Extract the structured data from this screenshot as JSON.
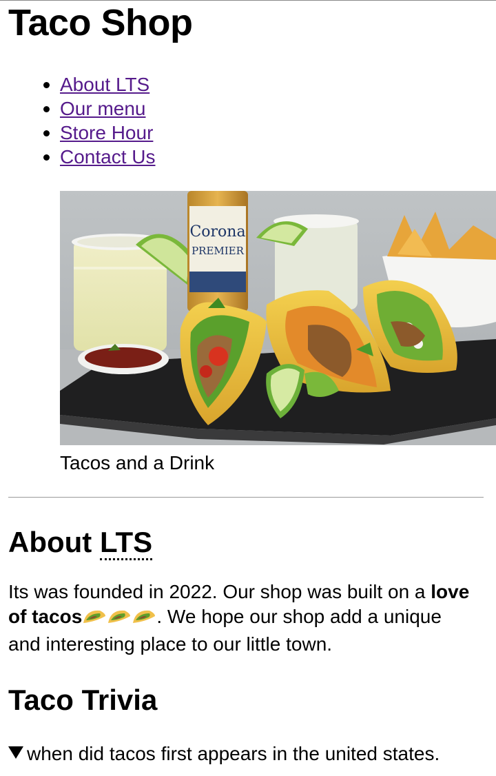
{
  "site": {
    "title": "Taco Shop"
  },
  "nav": {
    "items": [
      {
        "label": "About LTS"
      },
      {
        "label": "Our menu"
      },
      {
        "label": "Store Hour"
      },
      {
        "label": "Contact Us"
      }
    ]
  },
  "hero": {
    "caption": "Tacos and a Drink",
    "bottle_label_line1": "Corona",
    "bottle_label_line2": "PREMIER"
  },
  "about": {
    "heading_prefix": "About ",
    "heading_abbr": "LTS",
    "text_before": "Its was founded in 2022. Our shop was built on a ",
    "text_bold": "love of tacos",
    "text_after": ". We hope our shop add a unique and interesting place to our little town."
  },
  "trivia": {
    "heading": "Taco Trivia",
    "question": "when did tacos first appears in the united states."
  },
  "colors": {
    "link": "#551a8b",
    "text": "#000000",
    "divider": "#9a9a9a"
  }
}
